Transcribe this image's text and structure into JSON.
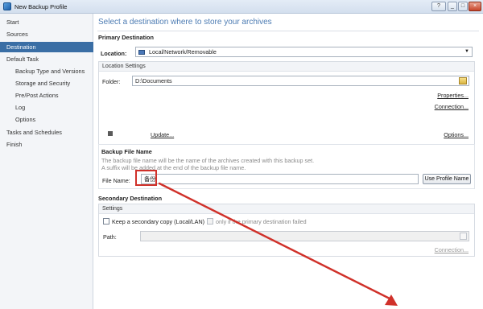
{
  "window": {
    "title": "New Backup Profile"
  },
  "window_controls": {
    "help": "?",
    "minimize": "_",
    "maximize": "□",
    "close": "×"
  },
  "sidebar": {
    "items": [
      {
        "label": "Start"
      },
      {
        "label": "Sources"
      },
      {
        "label": "Destination"
      },
      {
        "label": "Default Task"
      },
      {
        "label": "Backup Type and Versions"
      },
      {
        "label": "Storage and Security"
      },
      {
        "label": "Pre/Post Actions"
      },
      {
        "label": "Log"
      },
      {
        "label": "Options"
      },
      {
        "label": "Tasks and Schedules"
      },
      {
        "label": "Finish"
      }
    ],
    "selected": "Destination"
  },
  "main": {
    "headline": "Select a destination where to store your archives",
    "primary": {
      "title": "Primary Destination",
      "location_label": "Location:",
      "location_value": "Local/Network/Removable",
      "settings_title": "Location Settings",
      "folder_label": "Folder:",
      "folder_value": "D:\\Documents",
      "properties_link": "Properties...",
      "connection_link": "Connection...",
      "update_link": "Update...",
      "options_link": "Options..."
    },
    "backup_file": {
      "title": "Backup File Name",
      "desc1": "The backup file name will be the name of the archives created with this backup set.",
      "desc2": "A suffix will be added at the end of the backup file name.",
      "file_name_label": "File Name:",
      "file_name_value": "备份",
      "use_profile_name_button": "Use Profile Name"
    },
    "secondary": {
      "title": "Secondary Destination",
      "settings_title": "Settings",
      "keep_copy_label": "Keep a secondary copy (Local/LAN)",
      "only_if_failed_label": "only if the primary destination failed",
      "path_label": "Path:",
      "path_value": "",
      "connection_link": "Connection..."
    }
  },
  "colors": {
    "accent": "#3a6ea5",
    "headline": "#4d7cb3",
    "annotation": "#d0312a"
  }
}
